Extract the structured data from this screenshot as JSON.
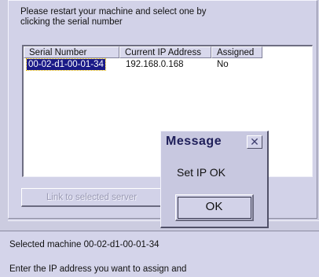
{
  "instruction": {
    "line1": "Please restart your machine and select one by",
    "line2": "clicking the serial number"
  },
  "list": {
    "columns": [
      "Serial Number",
      "Current IP Address",
      "Assigned"
    ],
    "rows": [
      {
        "serial": "00-02-d1-00-01-34",
        "ip": "192.168.0.168",
        "assigned": "No"
      }
    ]
  },
  "buttons": {
    "link_label": "Link to selected server"
  },
  "status": {
    "selected": "Selected machine 00-02-d1-00-01-34",
    "enter_ip": "Enter the IP address you want to assign and"
  },
  "dialog": {
    "title": "Message",
    "close_icon": "close-icon",
    "message": "Set IP OK",
    "ok_label": "OK"
  }
}
